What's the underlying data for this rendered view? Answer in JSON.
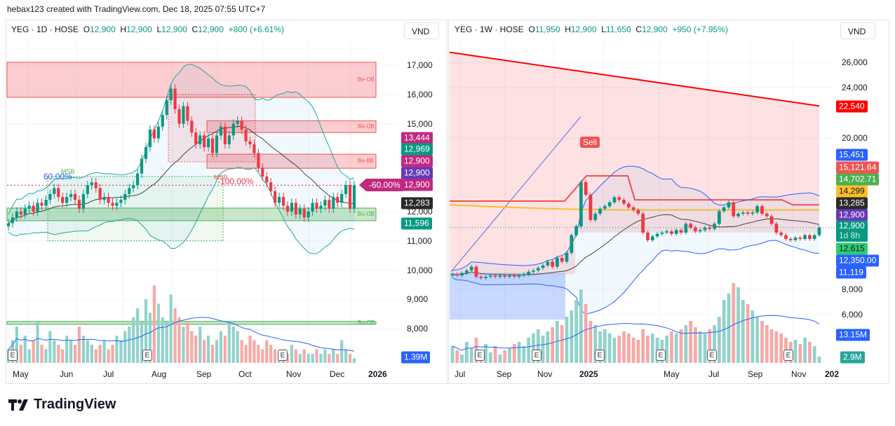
{
  "credit": "hebax123 created with TradingView.com, Dec 18, 2025 07:55 UTC+7",
  "logo_text": "TradingView",
  "chart_data": [
    {
      "type": "candlestick",
      "symbol": "YEG · 1D · HOSE",
      "ohlc": {
        "o_label": "O",
        "o": "12,900",
        "h_label": "H",
        "h": "12,900",
        "l_label": "L",
        "l": "12,900",
        "c_label": "C",
        "c": "12,900",
        "change": "+800 (+6.61%)"
      },
      "currency": "VND",
      "ylim": [
        7500,
        18000
      ],
      "y_ticks": [
        "17,000",
        "16,000",
        "15,000",
        "12,000",
        "11,000",
        "10,000",
        "9,000",
        "8,000"
      ],
      "y_tick_values": [
        17000,
        16000,
        15000,
        12000,
        11000,
        10000,
        9000,
        8000
      ],
      "x_ticks": [
        "May",
        "Jun",
        "Jul",
        "Aug",
        "Sep",
        "Oct",
        "Nov",
        "Dec",
        "2026"
      ],
      "closes": [
        11600,
        11800,
        12000,
        11900,
        12100,
        12200,
        12000,
        12300,
        12200,
        12400,
        12600,
        12800,
        12500,
        12300,
        12500,
        12600,
        12400,
        12100,
        12600,
        12900,
        13000,
        12800,
        12400,
        12500,
        12300,
        12200,
        12300,
        12400,
        12600,
        12800,
        12900,
        13300,
        13800,
        14200,
        14800,
        14500,
        14900,
        15300,
        15800,
        16200,
        15500,
        15000,
        15600,
        15100,
        14700,
        14300,
        14600,
        14200,
        14500,
        14000,
        14600,
        14900,
        14300,
        14600,
        15000,
        15100,
        14800,
        14400,
        14300,
        14000,
        13500,
        13200,
        13000,
        12700,
        12300,
        12500,
        12200,
        12000,
        12300,
        11900,
        12100,
        11800,
        12000,
        12300,
        12100,
        12200,
        12400,
        12100,
        12500,
        12300,
        12600,
        12900,
        12100,
        12900
      ],
      "volume_m": [
        3,
        5,
        8,
        4,
        6,
        3,
        5,
        9,
        4,
        3,
        7,
        5,
        4,
        3,
        6,
        5,
        4,
        8,
        6,
        5,
        4,
        3,
        4,
        5,
        3,
        4,
        6,
        5,
        7,
        8,
        10,
        12,
        9,
        14,
        11,
        17,
        13,
        10,
        9,
        15,
        12,
        10,
        8,
        9,
        7,
        6,
        8,
        5,
        6,
        4,
        5,
        7,
        6,
        9,
        8,
        7,
        5,
        4,
        6,
        5,
        4,
        3,
        5,
        4,
        3,
        2,
        3,
        2,
        4,
        3,
        2,
        3,
        2,
        2,
        3,
        2,
        3,
        2,
        3,
        2,
        5,
        3,
        2,
        1
      ],
      "volume_ma_label": "1.39M",
      "zones": [
        {
          "label": "Be-OB",
          "from": 15900,
          "to": 17100
        },
        {
          "label": "Be-OB",
          "from": 14700,
          "to": 15100
        },
        {
          "label": "Be-BB",
          "from": 13480,
          "to": 13960
        },
        {
          "label": "Bu-OB",
          "from": 11690,
          "to": 12120
        },
        {
          "label": "Bu-OB",
          "from": 8150,
          "to": 8250
        }
      ],
      "annotations": {
        "fib_up": "60.00%",
        "msb_1": "MSB",
        "fib_down": "-100.00%",
        "msb_2": "MSB",
        "pointer": "-60.00%",
        "earnings": "E"
      },
      "price_tags": [
        {
          "value": "13,444",
          "color": "#c2287f"
        },
        {
          "value": "12,969",
          "color": "#089981"
        },
        {
          "value": "12,900",
          "color": "#c2287f"
        },
        {
          "value": "12,900",
          "color": "#673ab7"
        },
        {
          "value": "12,900",
          "color": "#c2287f"
        },
        {
          "value": "12,283",
          "color": "#2a2a2a"
        },
        {
          "value": "11,596",
          "color": "#089981"
        }
      ]
    },
    {
      "type": "candlestick",
      "symbol": "YEG · 1W · HOSE",
      "ohlc": {
        "o_label": "O",
        "o": "11,950",
        "h_label": "H",
        "h": "12,900",
        "l_label": "L",
        "l": "11,650",
        "c_label": "C",
        "c": "12,900",
        "change": "+950 (+7.95%)"
      },
      "currency": "VND",
      "ylim": [
        5000,
        27500
      ],
      "y_ticks": [
        "26,000",
        "24,000",
        "20,000",
        "8,000",
        "6,000"
      ],
      "y_tick_values": [
        26000,
        24000,
        20000,
        8000,
        6000
      ],
      "x_ticks": [
        "Jul",
        "Sep",
        "Nov",
        "2025",
        "May",
        "Jul",
        "Sep",
        "Nov",
        "202"
      ],
      "closes": [
        9200,
        9100,
        9300,
        9500,
        9800,
        9000,
        8900,
        9000,
        9100,
        9000,
        9100,
        9000,
        9100,
        9000,
        9100,
        9200,
        9400,
        9500,
        9700,
        9900,
        10200,
        9800,
        10500,
        10200,
        10900,
        12300,
        13000,
        16500,
        15500,
        13500,
        14000,
        14400,
        14600,
        14900,
        15300,
        15100,
        14800,
        14500,
        14300,
        14000,
        12500,
        11900,
        12200,
        12400,
        12500,
        12600,
        12400,
        12700,
        12500,
        13200,
        12900,
        12600,
        12700,
        12900,
        12800,
        13200,
        14200,
        14500,
        14900,
        13800,
        14000,
        14100,
        14000,
        14100,
        14600,
        14000,
        13800,
        13200,
        12500,
        12300,
        12000,
        11900,
        12100,
        12000,
        12300,
        12000,
        12300,
        12900
      ],
      "volume_m": [
        8,
        6,
        4,
        10,
        7,
        12,
        6,
        9,
        5,
        8,
        4,
        6,
        7,
        9,
        10,
        8,
        12,
        14,
        16,
        13,
        15,
        17,
        20,
        18,
        22,
        25,
        30,
        35,
        28,
        20,
        18,
        15,
        16,
        14,
        12,
        13,
        15,
        14,
        12,
        11,
        16,
        13,
        14,
        12,
        11,
        13,
        15,
        14,
        16,
        18,
        20,
        17,
        15,
        14,
        16,
        18,
        22,
        30,
        33,
        38,
        36,
        30,
        28,
        25,
        22,
        20,
        18,
        16,
        15,
        14,
        12,
        10,
        11,
        9,
        12,
        10,
        8,
        3
      ],
      "volume_ma_label": "13.15M",
      "volume_last_label": "2.9M",
      "trendline": {
        "start": 26800,
        "end": 22540
      },
      "yellow_ma": {
        "start": 14700,
        "end": 14299
      },
      "annotations": {
        "signal": "Sell",
        "earnings": "E"
      },
      "price_tags": [
        {
          "value": "22,540",
          "color": "#ff0000",
          "text": "#fff"
        },
        {
          "value": "15,451",
          "color": "#2962ff",
          "text": "#fff"
        },
        {
          "value": "15,121.64",
          "color": "#f05350",
          "text": "#fff"
        },
        {
          "value": "14,702.71",
          "color": "#4caf50",
          "text": "#fff"
        },
        {
          "value": "14,299",
          "color": "#fbc02d",
          "text": "#131722"
        },
        {
          "value": "13,285",
          "color": "#2a2a2a",
          "text": "#fff"
        },
        {
          "value": "12,900",
          "color": "#673ab7",
          "text": "#fff"
        },
        {
          "value": "12,900",
          "color": "#089981",
          "text": "#fff",
          "sub": "1d 8h"
        },
        {
          "value": "12,615",
          "color": "#2ecc71",
          "text": "#131722"
        },
        {
          "value": "12,350.00",
          "color": "#2962ff",
          "text": "#fff"
        },
        {
          "value": "11,119",
          "color": "#2962ff",
          "text": "#fff"
        }
      ]
    }
  ]
}
